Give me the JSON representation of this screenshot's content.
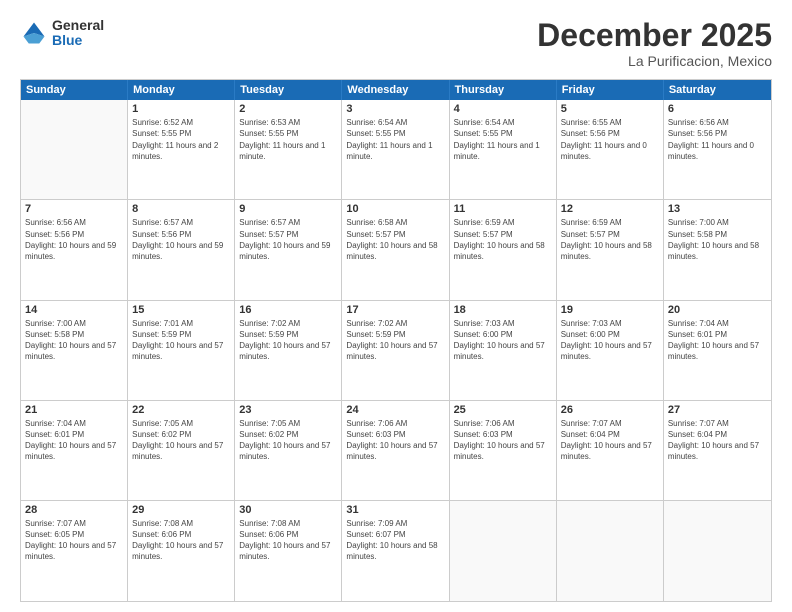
{
  "header": {
    "logo_general": "General",
    "logo_blue": "Blue",
    "month_title": "December 2025",
    "location": "La Purificacion, Mexico"
  },
  "weekdays": [
    "Sunday",
    "Monday",
    "Tuesday",
    "Wednesday",
    "Thursday",
    "Friday",
    "Saturday"
  ],
  "weeks": [
    [
      {
        "day": "",
        "empty": true
      },
      {
        "day": "1",
        "sunrise": "Sunrise: 6:52 AM",
        "sunset": "Sunset: 5:55 PM",
        "daylight": "Daylight: 11 hours and 2 minutes."
      },
      {
        "day": "2",
        "sunrise": "Sunrise: 6:53 AM",
        "sunset": "Sunset: 5:55 PM",
        "daylight": "Daylight: 11 hours and 1 minute."
      },
      {
        "day": "3",
        "sunrise": "Sunrise: 6:54 AM",
        "sunset": "Sunset: 5:55 PM",
        "daylight": "Daylight: 11 hours and 1 minute."
      },
      {
        "day": "4",
        "sunrise": "Sunrise: 6:54 AM",
        "sunset": "Sunset: 5:55 PM",
        "daylight": "Daylight: 11 hours and 1 minute."
      },
      {
        "day": "5",
        "sunrise": "Sunrise: 6:55 AM",
        "sunset": "Sunset: 5:56 PM",
        "daylight": "Daylight: 11 hours and 0 minutes."
      },
      {
        "day": "6",
        "sunrise": "Sunrise: 6:56 AM",
        "sunset": "Sunset: 5:56 PM",
        "daylight": "Daylight: 11 hours and 0 minutes."
      }
    ],
    [
      {
        "day": "7",
        "sunrise": "Sunrise: 6:56 AM",
        "sunset": "Sunset: 5:56 PM",
        "daylight": "Daylight: 10 hours and 59 minutes."
      },
      {
        "day": "8",
        "sunrise": "Sunrise: 6:57 AM",
        "sunset": "Sunset: 5:56 PM",
        "daylight": "Daylight: 10 hours and 59 minutes."
      },
      {
        "day": "9",
        "sunrise": "Sunrise: 6:57 AM",
        "sunset": "Sunset: 5:57 PM",
        "daylight": "Daylight: 10 hours and 59 minutes."
      },
      {
        "day": "10",
        "sunrise": "Sunrise: 6:58 AM",
        "sunset": "Sunset: 5:57 PM",
        "daylight": "Daylight: 10 hours and 58 minutes."
      },
      {
        "day": "11",
        "sunrise": "Sunrise: 6:59 AM",
        "sunset": "Sunset: 5:57 PM",
        "daylight": "Daylight: 10 hours and 58 minutes."
      },
      {
        "day": "12",
        "sunrise": "Sunrise: 6:59 AM",
        "sunset": "Sunset: 5:57 PM",
        "daylight": "Daylight: 10 hours and 58 minutes."
      },
      {
        "day": "13",
        "sunrise": "Sunrise: 7:00 AM",
        "sunset": "Sunset: 5:58 PM",
        "daylight": "Daylight: 10 hours and 58 minutes."
      }
    ],
    [
      {
        "day": "14",
        "sunrise": "Sunrise: 7:00 AM",
        "sunset": "Sunset: 5:58 PM",
        "daylight": "Daylight: 10 hours and 57 minutes."
      },
      {
        "day": "15",
        "sunrise": "Sunrise: 7:01 AM",
        "sunset": "Sunset: 5:59 PM",
        "daylight": "Daylight: 10 hours and 57 minutes."
      },
      {
        "day": "16",
        "sunrise": "Sunrise: 7:02 AM",
        "sunset": "Sunset: 5:59 PM",
        "daylight": "Daylight: 10 hours and 57 minutes."
      },
      {
        "day": "17",
        "sunrise": "Sunrise: 7:02 AM",
        "sunset": "Sunset: 5:59 PM",
        "daylight": "Daylight: 10 hours and 57 minutes."
      },
      {
        "day": "18",
        "sunrise": "Sunrise: 7:03 AM",
        "sunset": "Sunset: 6:00 PM",
        "daylight": "Daylight: 10 hours and 57 minutes."
      },
      {
        "day": "19",
        "sunrise": "Sunrise: 7:03 AM",
        "sunset": "Sunset: 6:00 PM",
        "daylight": "Daylight: 10 hours and 57 minutes."
      },
      {
        "day": "20",
        "sunrise": "Sunrise: 7:04 AM",
        "sunset": "Sunset: 6:01 PM",
        "daylight": "Daylight: 10 hours and 57 minutes."
      }
    ],
    [
      {
        "day": "21",
        "sunrise": "Sunrise: 7:04 AM",
        "sunset": "Sunset: 6:01 PM",
        "daylight": "Daylight: 10 hours and 57 minutes."
      },
      {
        "day": "22",
        "sunrise": "Sunrise: 7:05 AM",
        "sunset": "Sunset: 6:02 PM",
        "daylight": "Daylight: 10 hours and 57 minutes."
      },
      {
        "day": "23",
        "sunrise": "Sunrise: 7:05 AM",
        "sunset": "Sunset: 6:02 PM",
        "daylight": "Daylight: 10 hours and 57 minutes."
      },
      {
        "day": "24",
        "sunrise": "Sunrise: 7:06 AM",
        "sunset": "Sunset: 6:03 PM",
        "daylight": "Daylight: 10 hours and 57 minutes."
      },
      {
        "day": "25",
        "sunrise": "Sunrise: 7:06 AM",
        "sunset": "Sunset: 6:03 PM",
        "daylight": "Daylight: 10 hours and 57 minutes."
      },
      {
        "day": "26",
        "sunrise": "Sunrise: 7:07 AM",
        "sunset": "Sunset: 6:04 PM",
        "daylight": "Daylight: 10 hours and 57 minutes."
      },
      {
        "day": "27",
        "sunrise": "Sunrise: 7:07 AM",
        "sunset": "Sunset: 6:04 PM",
        "daylight": "Daylight: 10 hours and 57 minutes."
      }
    ],
    [
      {
        "day": "28",
        "sunrise": "Sunrise: 7:07 AM",
        "sunset": "Sunset: 6:05 PM",
        "daylight": "Daylight: 10 hours and 57 minutes."
      },
      {
        "day": "29",
        "sunrise": "Sunrise: 7:08 AM",
        "sunset": "Sunset: 6:06 PM",
        "daylight": "Daylight: 10 hours and 57 minutes."
      },
      {
        "day": "30",
        "sunrise": "Sunrise: 7:08 AM",
        "sunset": "Sunset: 6:06 PM",
        "daylight": "Daylight: 10 hours and 57 minutes."
      },
      {
        "day": "31",
        "sunrise": "Sunrise: 7:09 AM",
        "sunset": "Sunset: 6:07 PM",
        "daylight": "Daylight: 10 hours and 58 minutes."
      },
      {
        "day": "",
        "empty": true
      },
      {
        "day": "",
        "empty": true
      },
      {
        "day": "",
        "empty": true
      }
    ]
  ]
}
